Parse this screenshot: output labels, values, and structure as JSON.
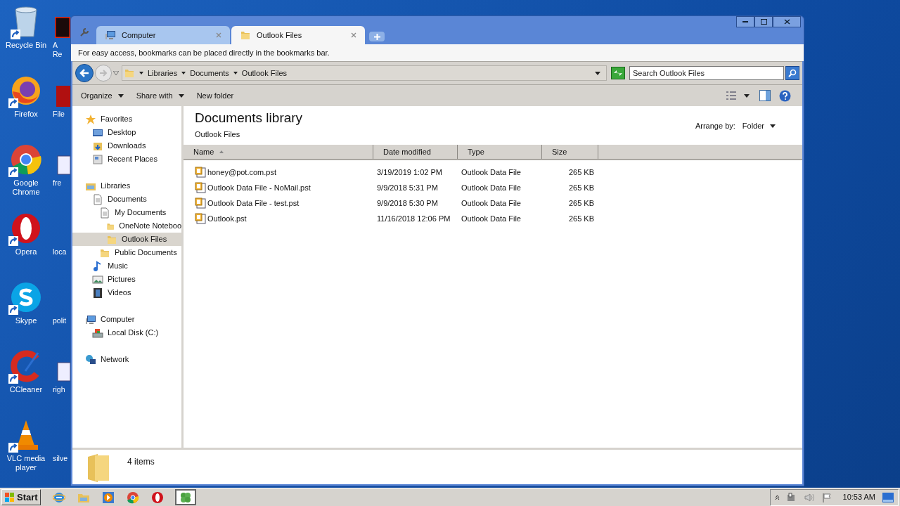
{
  "desktop_icons": [
    {
      "label": "Recycle Bin",
      "kind": "bin"
    },
    {
      "label": "Firefox",
      "kind": "firefox"
    },
    {
      "label": "Google Chrome",
      "kind": "chrome"
    },
    {
      "label": "Opera",
      "kind": "opera"
    },
    {
      "label": "Skype",
      "kind": "skype"
    },
    {
      "label": "CCleaner",
      "kind": "ccleaner"
    },
    {
      "label": "VLC media player",
      "kind": "vlc"
    }
  ],
  "desktop_icons_partial": [
    {
      "label": "A\nRe",
      "kind": "dark"
    },
    {
      "label": "File",
      "kind": "red"
    },
    {
      "label": "fre",
      "kind": "doc"
    },
    {
      "label": "loca",
      "kind": "none"
    },
    {
      "label": "polit",
      "kind": "none"
    },
    {
      "label": "righ",
      "kind": "doc"
    },
    {
      "label": "silve",
      "kind": "none"
    }
  ],
  "tabs": [
    {
      "label": "Computer",
      "kind": "computer",
      "selected": false
    },
    {
      "label": "Outlook Files",
      "kind": "folder",
      "selected": true
    }
  ],
  "bookmarks_hint": "For easy access, bookmarks can be placed directly in the bookmarks bar.",
  "breadcrumb": [
    "Libraries",
    "Documents",
    "Outlook Files"
  ],
  "search": {
    "placeholder": "Search Outlook Files"
  },
  "toolbar": [
    {
      "label": "Organize",
      "dropdown": true
    },
    {
      "label": "Share with",
      "dropdown": true
    },
    {
      "label": "New folder",
      "dropdown": false
    }
  ],
  "nav_tree": [
    {
      "label": "Favorites",
      "kind": "star",
      "selected": false,
      "children": [
        {
          "label": "Desktop",
          "kind": "desktop",
          "selected": false
        },
        {
          "label": "Downloads",
          "kind": "downloads",
          "selected": false
        },
        {
          "label": "Recent Places",
          "kind": "recent",
          "selected": false
        }
      ]
    },
    {
      "label": "Libraries",
      "kind": "library",
      "selected": false,
      "children": [
        {
          "label": "Documents",
          "kind": "documents",
          "selected": false,
          "children": [
            {
              "label": "My Documents",
              "kind": "documents",
              "selected": false,
              "children": [
                {
                  "label": "OneNote Noteboo",
                  "kind": "folder",
                  "selected": false
                },
                {
                  "label": "Outlook Files",
                  "kind": "folder",
                  "selected": true
                }
              ]
            },
            {
              "label": "Public Documents",
              "kind": "folder",
              "selected": false
            }
          ]
        },
        {
          "label": "Music",
          "kind": "music",
          "selected": false
        },
        {
          "label": "Pictures",
          "kind": "pictures",
          "selected": false
        },
        {
          "label": "Videos",
          "kind": "videos",
          "selected": false
        }
      ]
    },
    {
      "label": "Computer",
      "kind": "computer",
      "selected": false,
      "children": [
        {
          "label": "Local Disk (C:)",
          "kind": "disk",
          "selected": false
        }
      ]
    },
    {
      "label": "Network",
      "kind": "network",
      "selected": false
    }
  ],
  "library": {
    "title": "Documents library",
    "subtitle": "Outlook Files",
    "arrange_label": "Arrange by:",
    "arrange_value": "Folder"
  },
  "table": {
    "columns": [
      "Name",
      "Date modified",
      "Type",
      "Size"
    ],
    "rows": [
      [
        "honey@pot.com.pst",
        "3/19/2019 1:02 PM",
        "Outlook Data File",
        "265 KB"
      ],
      [
        "Outlook Data File - NoMail.pst",
        "9/9/2018 5:31 PM",
        "Outlook Data File",
        "265 KB"
      ],
      [
        "Outlook Data File - test.pst",
        "9/9/2018 5:30 PM",
        "Outlook Data File",
        "265 KB"
      ],
      [
        "Outlook.pst",
        "11/16/2018 12:06 PM",
        "Outlook Data File",
        "265 KB"
      ]
    ]
  },
  "status": {
    "count": "4 items"
  },
  "taskbar": {
    "start": "Start",
    "apps": [
      {
        "kind": "ie",
        "selected": false
      },
      {
        "kind": "explorer",
        "selected": false
      },
      {
        "kind": "media",
        "selected": false
      },
      {
        "kind": "chrome",
        "selected": false
      },
      {
        "kind": "opera",
        "selected": false
      },
      {
        "kind": "clover",
        "selected": true
      }
    ],
    "clock": "10:53 AM"
  }
}
